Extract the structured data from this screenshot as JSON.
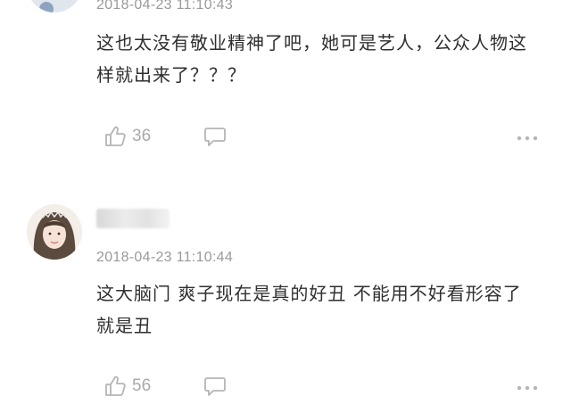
{
  "comments": [
    {
      "timestamp": "2018-04-23 11:10:43",
      "content": "这也太没有敬业精神了吧，她可是艺人，公众人物这样就出来了？？？",
      "likes": "36",
      "icons": {
        "like": "thumbs-up-icon",
        "reply": "comment-bubble-icon",
        "more": "more-dots-icon"
      }
    },
    {
      "timestamp": "2018-04-23 11:10:44",
      "content": "这大脑门 爽子现在是真的好丑 不能用不好看形容了 就是丑",
      "likes": "56",
      "icons": {
        "like": "thumbs-up-icon",
        "reply": "comment-bubble-icon",
        "more": "more-dots-icon"
      }
    }
  ],
  "colors": {
    "text": "#2f2f2f",
    "meta": "#9a9a9a",
    "icon": "#b5b5b5"
  }
}
